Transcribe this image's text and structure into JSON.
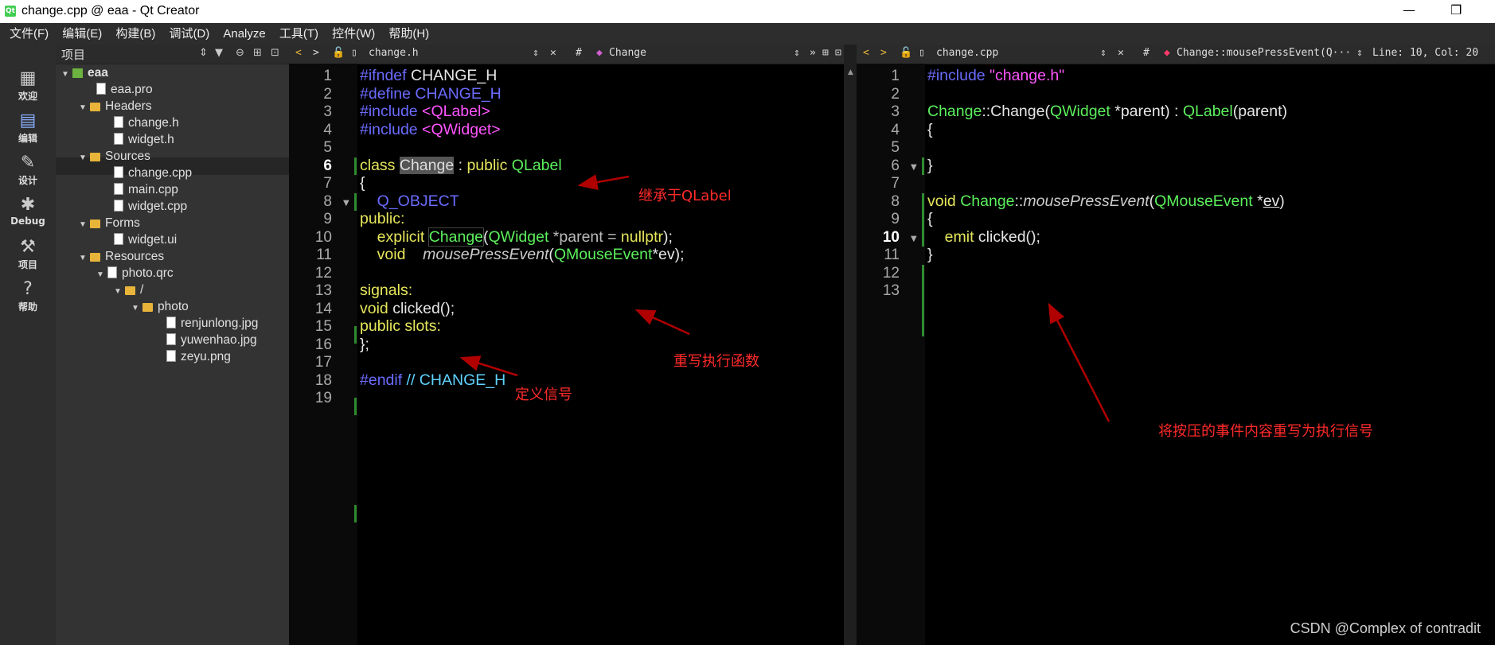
{
  "window": {
    "title": "change.cpp @ eaa - Qt Creator",
    "app_icon": "Qt"
  },
  "menu": [
    "文件(F)",
    "编辑(E)",
    "构建(B)",
    "调试(D)",
    "Analyze",
    "工具(T)",
    "控件(W)",
    "帮助(H)"
  ],
  "modes": [
    {
      "label": "欢迎",
      "icon": "grid-icon"
    },
    {
      "label": "编辑",
      "icon": "edit-icon"
    },
    {
      "label": "设计",
      "icon": "pencil-icon"
    },
    {
      "label": "Debug",
      "icon": "bug-icon"
    },
    {
      "label": "项目",
      "icon": "wrench-icon"
    },
    {
      "label": "帮助",
      "icon": "help-icon"
    }
  ],
  "project": {
    "header": "项目",
    "tree": [
      {
        "label": "eaa"
      },
      {
        "label": "eaa.pro"
      },
      {
        "label": "Headers"
      },
      {
        "label": "change.h"
      },
      {
        "label": "widget.h"
      },
      {
        "label": "Sources"
      },
      {
        "label": "change.cpp"
      },
      {
        "label": "main.cpp"
      },
      {
        "label": "widget.cpp"
      },
      {
        "label": "Forms"
      },
      {
        "label": "widget.ui"
      },
      {
        "label": "Resources"
      },
      {
        "label": "photo.qrc"
      },
      {
        "label": "/"
      },
      {
        "label": "photo"
      },
      {
        "label": "renjunlong.jpg"
      },
      {
        "label": "yuwenhao.jpg"
      },
      {
        "label": "zeyu.png"
      }
    ]
  },
  "left_editor": {
    "file": "change.h",
    "hash": "#",
    "symbol": "Change",
    "line_numbers": [
      "1",
      "2",
      "3",
      "4",
      "5",
      "6",
      "7",
      "8",
      "9",
      "10",
      "11",
      "12",
      "13",
      "14",
      "15",
      "16",
      "17",
      "18",
      "19"
    ],
    "code": {
      "l1a": "#ifndef",
      "l1b": " CHANGE_H",
      "l2a": "#define",
      "l2b": " CHANGE_H",
      "l3a": "#include",
      "l3b": " <QLabel>",
      "l4a": "#include",
      "l4b": " <QWidget>",
      "l6a": "class",
      "l6b": "Change",
      "l6c": " : ",
      "l6d": "public",
      "l6e": " QLabel",
      "l7": "{",
      "l8": "    Q_OBJECT",
      "l9": "public:",
      "l10a": "    explicit",
      "l10b": "Change",
      "l10c": "(",
      "l10d": "QWidget",
      "l10e": " *parent = ",
      "l10f": "nullptr",
      "l10g": ");",
      "l11a": "    void",
      "l11b": "    mousePressEvent",
      "l11c": "(",
      "l11d": "QMouseEvent",
      "l11e": "*ev);",
      "l13": "signals:",
      "l14a": "void",
      "l14b": " clicked();",
      "l15": "public slots:",
      "l16": "};",
      "l18a": "#endif",
      "l18b": " // CHANGE_H"
    }
  },
  "right_editor": {
    "file": "change.cpp",
    "hash": "#",
    "symbol": "Change::mousePressEvent(Q···",
    "position": "Line: 10, Col: 20",
    "line_numbers": [
      "1",
      "2",
      "3",
      "4",
      "5",
      "6",
      "7",
      "8",
      "9",
      "10",
      "11",
      "12",
      "13"
    ],
    "code": {
      "l1a": "#include",
      "l1b": " \"change.h\"",
      "l3a": "Change",
      "l3b": "::Change(",
      "l3c": "QWidget",
      "l3d": " *parent) : ",
      "l3e": "QLabel",
      "l3f": "(parent)",
      "l4": "{",
      "l6": "}",
      "l8a": "void",
      "l8b": " Change",
      "l8c": "::",
      "l8d": "mousePressEvent",
      "l8e": "(",
      "l8f": "QMouseEvent",
      "l8g": " *",
      "l8h": "ev",
      "l8i": ")",
      "l9": "{",
      "l10a": "    emit",
      "l10b": " clicked();",
      "l11": "}"
    }
  },
  "annotations": {
    "inherit": "继承于QLabel",
    "override": "重写执行函数",
    "signal": "定义信号",
    "rewrite": "将按压的事件内容重写为执行信号"
  },
  "watermark": "CSDN @Complex of contradit",
  "colors": {
    "annotation": "#ff2a2a",
    "arrow": "#b00000",
    "keyword": "#e6e65c",
    "type": "#5cf05c",
    "preprocessor": "#6b6bff",
    "include": "#ff55ff"
  }
}
